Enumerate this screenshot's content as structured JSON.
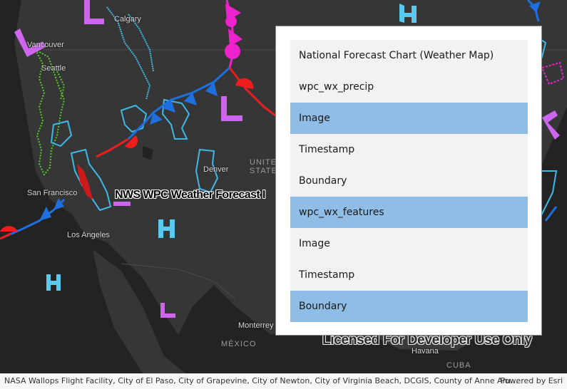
{
  "map": {
    "cities": [
      {
        "name": "Calgary"
      },
      {
        "name": "Vancouver"
      },
      {
        "name": "Seattle"
      },
      {
        "name": "Denver"
      },
      {
        "name": "San Francisco"
      },
      {
        "name": "Los Angeles"
      },
      {
        "name": "Monterrey"
      },
      {
        "name": "Havana"
      }
    ],
    "country_labels": [
      "UNITED",
      "STATES",
      "MÉXICO",
      "CUBA"
    ],
    "layer_title": "NWS WPC Weather Forecast I",
    "watermark": "Licensed For Developer Use Only",
    "pressure_letters": [
      "L",
      "H"
    ],
    "colors": {
      "background": "#2b2b2b",
      "land": "#363636",
      "water": "#232323",
      "cold_front": "#1e6fe0",
      "warm_front": "#ee1d1d",
      "occluded_front": "#ee22cc",
      "low_symbol": "#cc66ee",
      "high_symbol": "#5bc8ee",
      "precip_light_blue": "#3fb8e8",
      "precip_green": "#55cc22"
    }
  },
  "panel": {
    "items": [
      {
        "label": "National Forecast Chart (Weather Map)",
        "selected": false
      },
      {
        "label": "wpc_wx_precip",
        "selected": false
      },
      {
        "label": "Image",
        "selected": true
      },
      {
        "label": "Timestamp",
        "selected": false
      },
      {
        "label": "Boundary",
        "selected": false
      },
      {
        "label": "wpc_wx_features",
        "selected": true
      },
      {
        "label": "Image",
        "selected": false
      },
      {
        "label": "Timestamp",
        "selected": false
      },
      {
        "label": "Boundary",
        "selected": true
      }
    ],
    "selected_color": "#8fbde6",
    "row_color": "#f2f2f2"
  },
  "attribution": {
    "text": "NASA Wallops Flight Facility, City of El Paso, City of Grapevine, City of Newton, City of Virginia Beach, DCGIS, County of Anne Aru...",
    "powered_by": "Powered by Esri"
  }
}
